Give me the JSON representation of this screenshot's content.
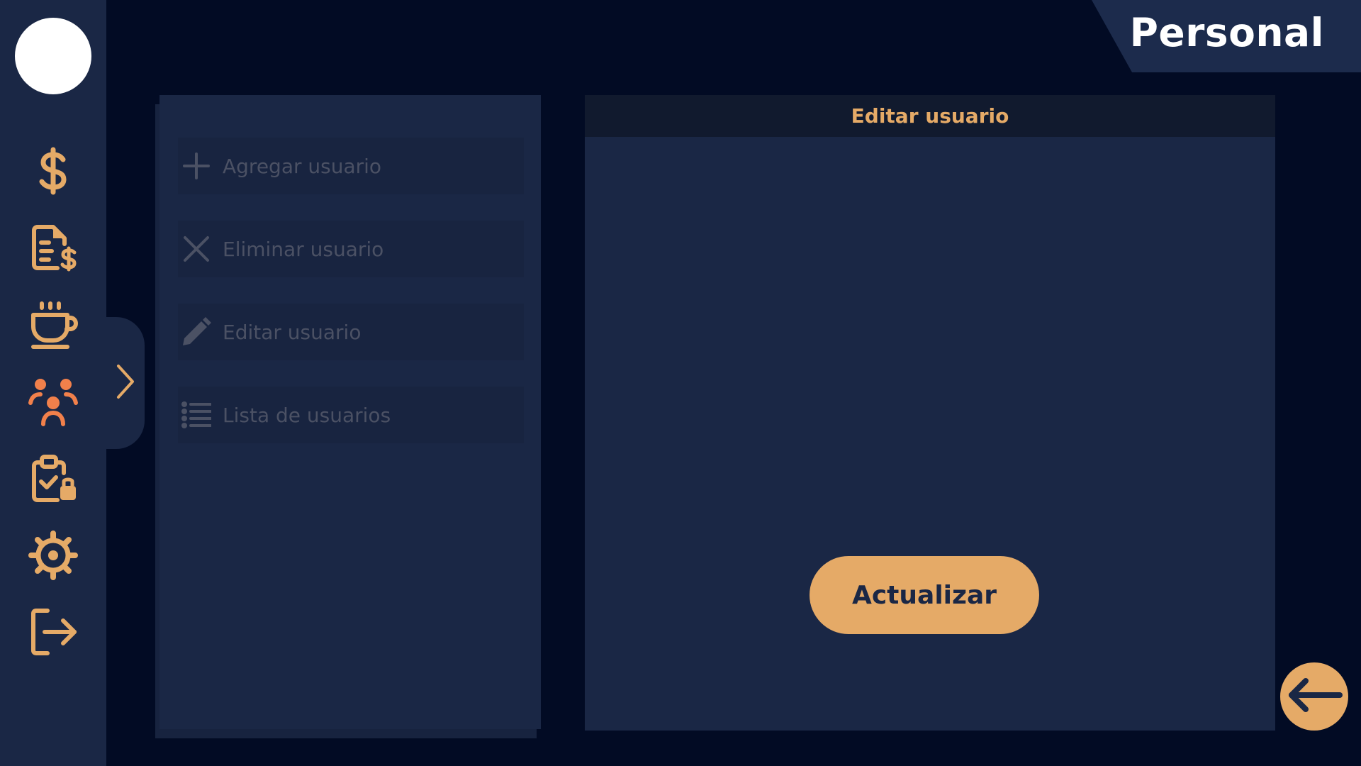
{
  "page": {
    "title": "Personal"
  },
  "nav": {
    "items": [
      {
        "icon": "dollar-icon"
      },
      {
        "icon": "invoice-icon"
      },
      {
        "icon": "coffee-cup-icon"
      },
      {
        "icon": "users-group-icon",
        "active": true
      },
      {
        "icon": "clipboard-check-icon"
      },
      {
        "icon": "gear-icon"
      },
      {
        "icon": "logout-icon"
      }
    ]
  },
  "menu": {
    "items": [
      {
        "label": "Agregar usuario",
        "icon": "plus-icon"
      },
      {
        "label": "Eliminar usuario",
        "icon": "close-icon"
      },
      {
        "label": "Editar usuario",
        "icon": "pencil-icon"
      },
      {
        "label": "Lista de usuarios",
        "icon": "list-icon"
      }
    ]
  },
  "editor": {
    "header": "Editar usuario",
    "submit_label": "Actualizar"
  },
  "colors": {
    "background": "#020b24",
    "panel": "#1a2745",
    "accent": "#e5aa67",
    "active_icon": "#f1804b",
    "muted_text": "#4b5164"
  }
}
